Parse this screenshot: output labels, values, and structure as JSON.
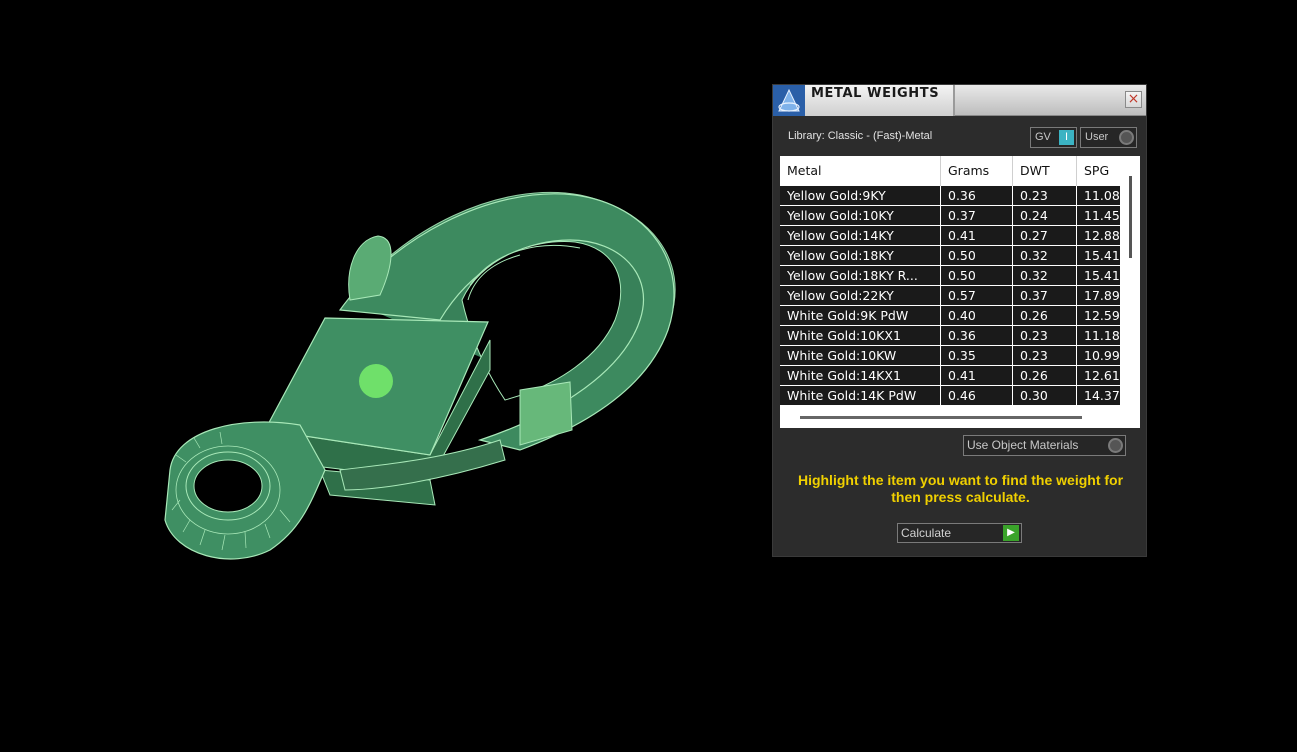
{
  "panel": {
    "title": "METAL WEIGHTS",
    "close_glyph": "×",
    "library_label": "Library: Classic - (Fast)-Metal",
    "gv_label": "GV",
    "gv_indicator": "I",
    "user_label": "User",
    "columns": [
      "Metal",
      "Grams",
      "DWT",
      "SPG"
    ],
    "rows": [
      [
        "Yellow Gold:9KY",
        "0.36",
        "0.23",
        "11.08"
      ],
      [
        "Yellow Gold:10KY",
        "0.37",
        "0.24",
        "11.45"
      ],
      [
        "Yellow Gold:14KY",
        "0.41",
        "0.27",
        "12.88"
      ],
      [
        "Yellow Gold:18KY",
        "0.50",
        "0.32",
        "15.41"
      ],
      [
        "Yellow Gold:18KY R...",
        "0.50",
        "0.32",
        "15.41"
      ],
      [
        "Yellow Gold:22KY",
        "0.57",
        "0.37",
        "17.89"
      ],
      [
        "White Gold:9K PdW",
        "0.40",
        "0.26",
        "12.59"
      ],
      [
        "White Gold:10KX1",
        "0.36",
        "0.23",
        "11.18"
      ],
      [
        "White Gold:10KW",
        "0.35",
        "0.23",
        "10.99"
      ],
      [
        "White Gold:14KX1",
        "0.41",
        "0.26",
        "12.61"
      ],
      [
        "White Gold:14K PdW",
        "0.46",
        "0.30",
        "14.37"
      ]
    ],
    "material_select_value": "Use Object Materials",
    "hint": "Highlight the item you want to find the weight for then press calculate.",
    "calculate_label": "Calculate",
    "calculate_icon": "play-arrow-icon"
  },
  "viewport": {
    "model": "lobster-clasp-3d-model",
    "model_color": "#3f8f63",
    "highlight_color": "#6fcf7a"
  }
}
